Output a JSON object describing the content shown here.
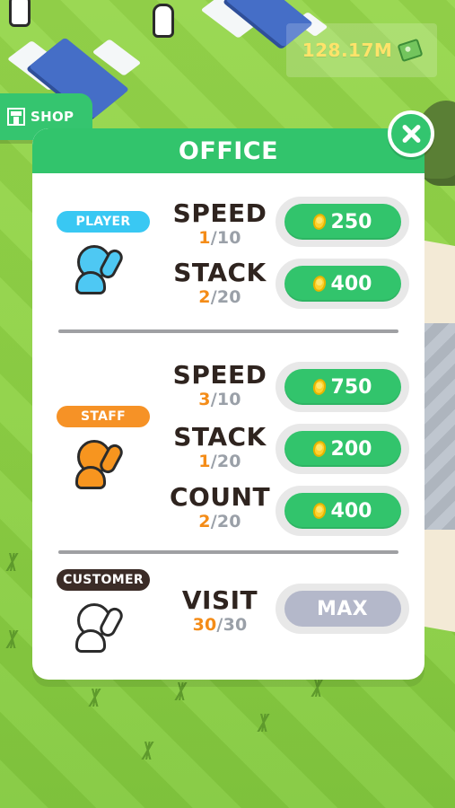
{
  "hud": {
    "money": "128.17M",
    "money_icon": "cash-icon"
  },
  "shop": {
    "label": "SHOP",
    "icon": "shop-icon"
  },
  "modal": {
    "title": "OFFICE",
    "close_icon": "close-icon",
    "sections": [
      {
        "category": "PLAYER",
        "category_color": "#39c8f3",
        "avatar_icon": "player-avatar-icon",
        "stats": [
          {
            "label": "SPEED",
            "current": "1",
            "separator": "/",
            "max": "10",
            "button": {
              "type": "upgrade",
              "coin_icon": "coin-icon",
              "value": "250"
            }
          },
          {
            "label": "STACK",
            "current": "2",
            "separator": "/",
            "max": "20",
            "button": {
              "type": "upgrade",
              "coin_icon": "coin-icon",
              "value": "400"
            }
          }
        ]
      },
      {
        "category": "STAFF",
        "category_color": "#f69226",
        "avatar_icon": "staff-avatar-icon",
        "stats": [
          {
            "label": "SPEED",
            "current": "3",
            "separator": "/",
            "max": "10",
            "button": {
              "type": "upgrade",
              "coin_icon": "coin-icon",
              "value": "750"
            }
          },
          {
            "label": "STACK",
            "current": "1",
            "separator": "/",
            "max": "20",
            "button": {
              "type": "upgrade",
              "coin_icon": "coin-icon",
              "value": "200"
            }
          },
          {
            "label": "COUNT",
            "current": "2",
            "separator": "/",
            "max": "20",
            "button": {
              "type": "upgrade",
              "coin_icon": "coin-icon",
              "value": "400"
            }
          }
        ]
      },
      {
        "category": "CUSTOMER",
        "category_color": "#3b2c27",
        "avatar_icon": "customer-avatar-icon",
        "stats": [
          {
            "label": "VISIT",
            "current": "30",
            "separator": "/",
            "max": "30",
            "button": {
              "type": "max",
              "value": "MAX"
            }
          }
        ]
      }
    ]
  },
  "colors": {
    "primary_green": "#32c46c",
    "disabled_button": "#b4b8ca",
    "current_value": "#f48c18",
    "max_value": "#9aa0a8",
    "money_text": "#ffe36a"
  }
}
